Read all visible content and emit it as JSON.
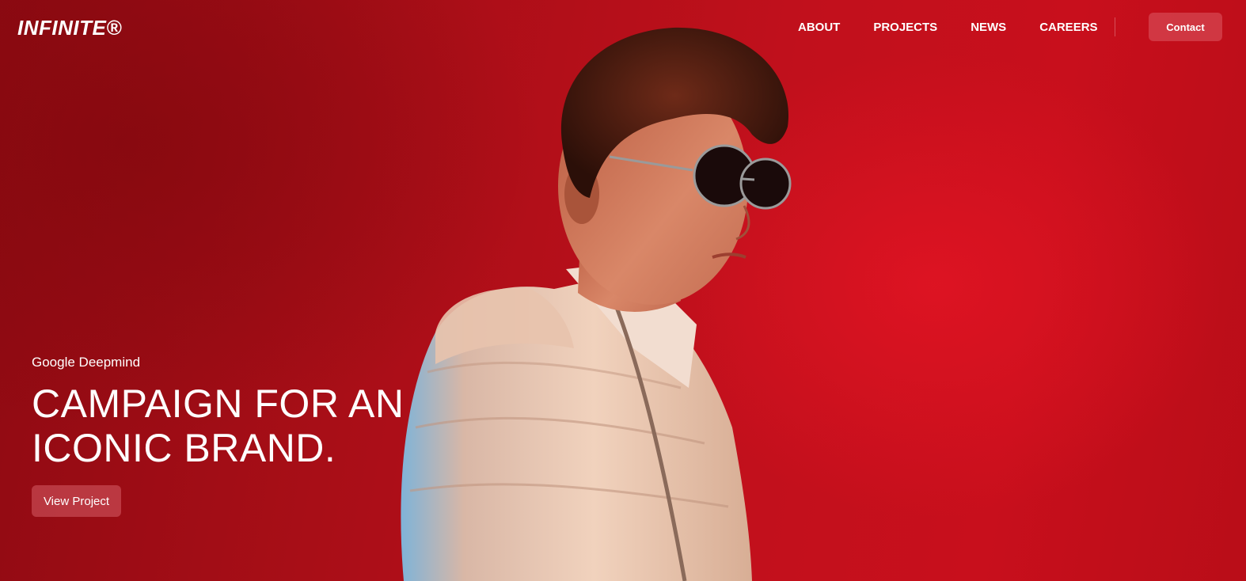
{
  "brand": {
    "logo_text": "INFINITE®"
  },
  "nav": {
    "links": [
      {
        "label": "ABOUT"
      },
      {
        "label": "PROJECTS"
      },
      {
        "label": "NEWS"
      },
      {
        "label": "CAREERS"
      }
    ],
    "contact_label": "Contact"
  },
  "hero": {
    "client": "Google Deepmind",
    "headline_line1": "CAMPAIGN FOR AN",
    "headline_line2": "ICONIC BRAND.",
    "cta_label": "View Project",
    "image_subject": "model-in-puffer-jacket-and-sunglasses"
  },
  "colors": {
    "background_red": "#c00f1c",
    "text": "#ffffff",
    "button_translucent": "#dc6470"
  }
}
